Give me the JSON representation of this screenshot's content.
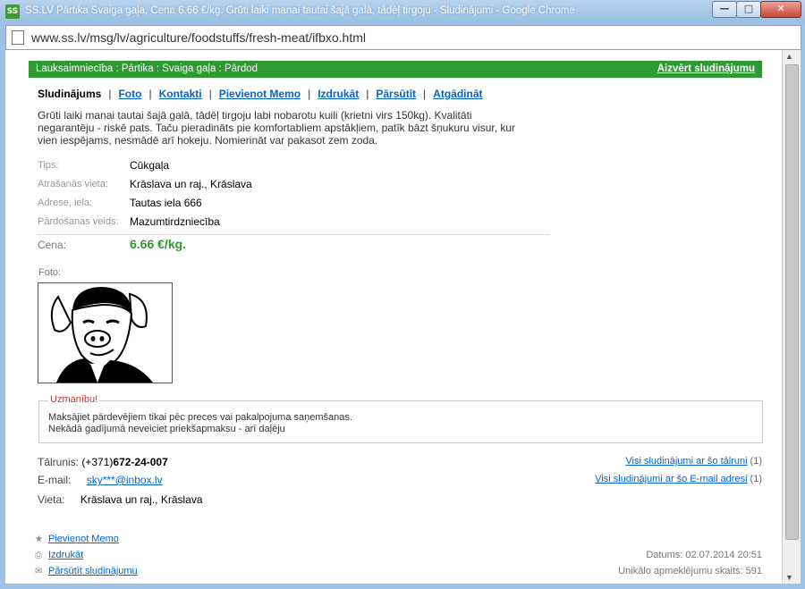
{
  "window": {
    "app_icon": "SS",
    "title": "SS.LV Pārtika Svaiga gaļa, Cena 6.66 €/kg. Grūti laiki manai tautai šajā galā, tādēļ tirgoju - Sludinājumi - Google Chrome",
    "controls": {
      "min": "—",
      "max": "□",
      "close": "✕"
    }
  },
  "address_bar": {
    "url": "www.ss.lv/msg/lv/agriculture/foodstuffs/fresh-meat/ifbxo.html"
  },
  "header": {
    "breadcrumb": "Lauksaimniecība : Pārtika : Svaiga gaļa : Pārdod",
    "close_label": "Aizvērt sludinājumu",
    "accent_color": "#2d9a32"
  },
  "tabs": [
    "Sludinājums",
    "Foto",
    "Kontakti",
    "Pievienot Memo",
    "Izdrukāt",
    "Pārsūtīt",
    "Atgādināt"
  ],
  "description": "Grūti laiki manai tautai šajā galā, tādēļ tirgoju labi nobarotu kuili (krietni virs 150kg). Kvalitāti negarantēju - riskē pats. Taču pieradināts pie komfortabliem apstākļiem, patīk bāzt šņukuru visur, kur vien iespējams, nesmādē arī hokeju. Nomierināt var pakasot zem zoda.",
  "details": [
    {
      "label": "Tips:",
      "value": "Cūkgaļa"
    },
    {
      "label": "Atrašanās vieta:",
      "value": "Krāslava un raj., Krāslava"
    },
    {
      "label": "Adrese, iela:",
      "value": "Tautas iela 666"
    },
    {
      "label": "Pārdošanas veids:",
      "value": "Mazumtirdzniecība"
    }
  ],
  "price": {
    "label": "Cena:",
    "value": "6.66 €/kg."
  },
  "photo": {
    "label": "Foto:"
  },
  "warning": {
    "title": "Uzmanību!",
    "line1": "Maksājiet pārdevējiem tikai pēc preces vai pakalpojuma saņemšanas.",
    "line2": "Nekādā gadījumā neveiciet priekšapmaksu - arī daļēju"
  },
  "contacts": {
    "phone_label": "Tālrunis:",
    "phone_prefix": "(+371)",
    "phone_number": "672-24-007",
    "email_label": "E-mail:",
    "email": "sky***@inbox.lv",
    "place_label": "Vieta:",
    "place": "Krāslava un raj., Krāslava",
    "all_by_phone": "Visi sludinājumi ar šo tālruni",
    "all_by_phone_count": "(1)",
    "all_by_email": "Visi sludinājumi ar šo E-mail adresi",
    "all_by_email_count": "(1)"
  },
  "footer": {
    "memo": "Pievienot Memo",
    "print": "Izdrukāt",
    "forward": "Pārsūtīt sludinājumu",
    "date": "Datums: 02.07.2014 20:51",
    "visits": "Unikālo apmeklējumu skaits: 591"
  }
}
